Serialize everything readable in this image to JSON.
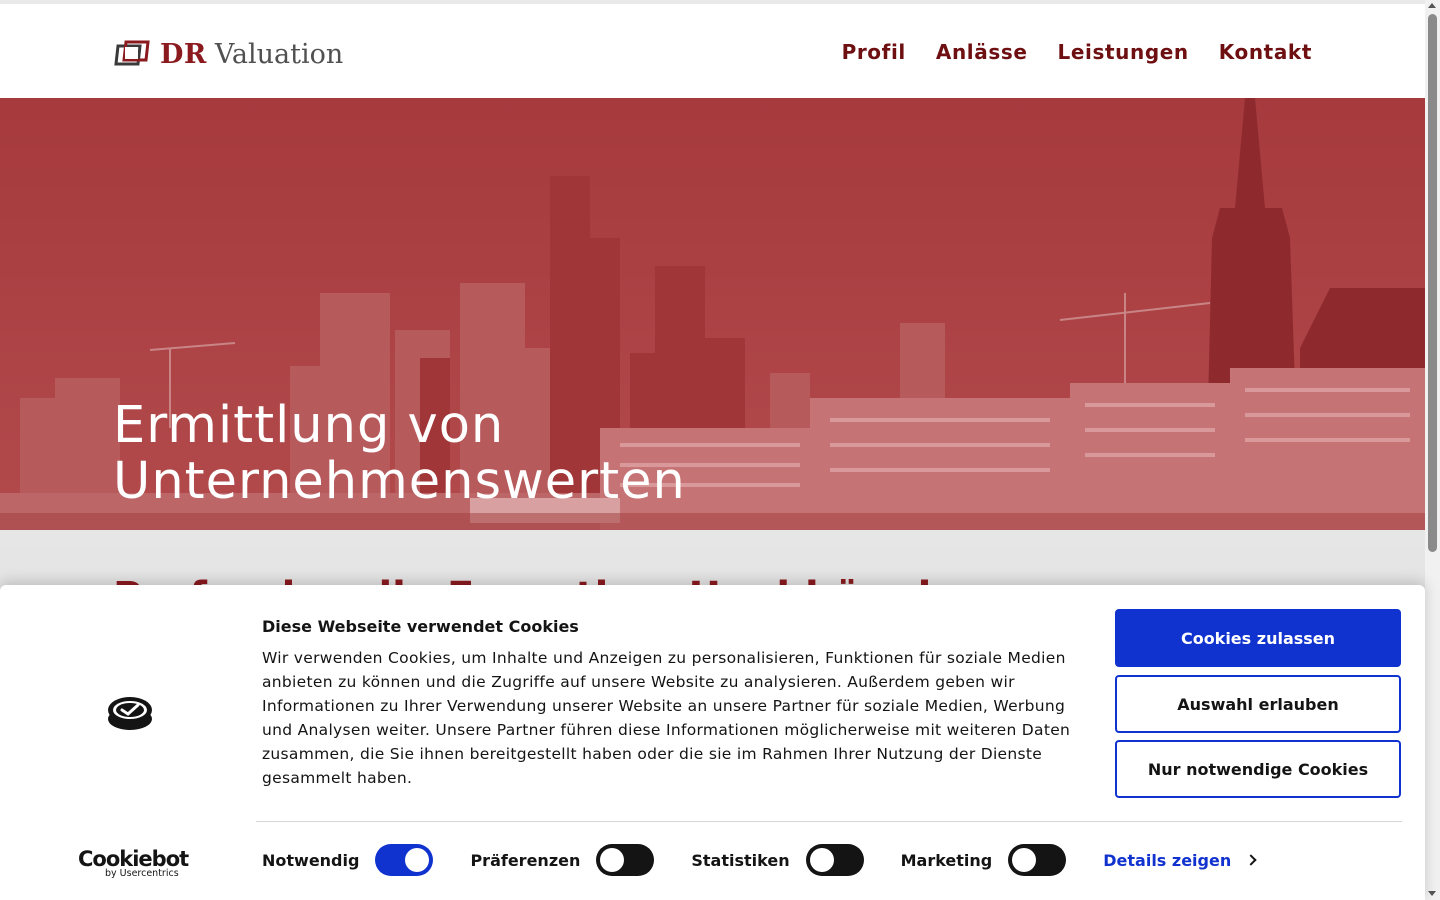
{
  "header": {
    "logo_dr": "DR",
    "logo_rest": "Valuation",
    "nav": [
      "Profil",
      "Anlässe",
      "Leistungen",
      "Kontakt"
    ]
  },
  "hero": {
    "title_line1": "Ermittlung von",
    "title_line2": "Unternehmenswerten"
  },
  "section": {
    "heading": "Professionelle Expertise. Unabhängig."
  },
  "cookie_banner": {
    "title": "Diese Webseite verwendet Cookies",
    "text": "Wir verwenden Cookies, um Inhalte und Anzeigen zu personalisieren, Funktionen für soziale Medien anbieten zu können und die Zugriffe auf unsere Website zu analysieren. Außerdem geben wir Informationen zu Ihrer Verwendung unserer Website an unsere Partner für soziale Medien, Werbung und Analysen weiter. Unsere Partner führen diese Informationen möglicherweise mit weiteren Daten zusammen, die Sie ihnen bereitgestellt haben oder die sie im Rahmen Ihrer Nutzung der Dienste gesammelt haben.",
    "buttons": {
      "allow_all": "Cookies zulassen",
      "allow_selection": "Auswahl erlauben",
      "necessary_only": "Nur notwendige Cookies"
    },
    "toggles": [
      {
        "label": "Notwendig",
        "on": true
      },
      {
        "label": "Präferenzen",
        "on": false
      },
      {
        "label": "Statistiken",
        "on": false
      },
      {
        "label": "Marketing",
        "on": false
      }
    ],
    "details_link": "Details zeigen",
    "brand_name": "Cookiebot",
    "brand_by": "by Usercentrics"
  },
  "colors": {
    "brand_red": "#8b1a1f",
    "nav_red": "#6e0f12",
    "hero_tint": "#a5383b",
    "cookie_blue": "#1032cf"
  }
}
